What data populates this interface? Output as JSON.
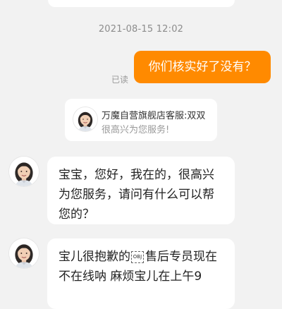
{
  "timestamp": "2021-08-15 12:02",
  "sent_message": {
    "text": "你们核实好了没有？",
    "status": "已读"
  },
  "service_card": {
    "title": "万魔自营旗舰店客服:双双",
    "subtitle": "很高兴为您服务!"
  },
  "messages": [
    {
      "text": "宝宝，您好，我在的，很高兴为您服务，请问有什么可以帮您的？"
    },
    {
      "text_before": "宝儿很抱歉的",
      "glyph": "OBJ",
      "text_after": "售后专员现在不在线呐  麻烦宝儿在上午9"
    }
  ],
  "colors": {
    "background": "#f2f2f2",
    "sent_bubble": "#ff8a00",
    "received_bubble": "#ffffff",
    "muted_text": "#8c8c8c"
  },
  "icons": {
    "agent_avatar": "woman-agent-avatar-icon"
  }
}
